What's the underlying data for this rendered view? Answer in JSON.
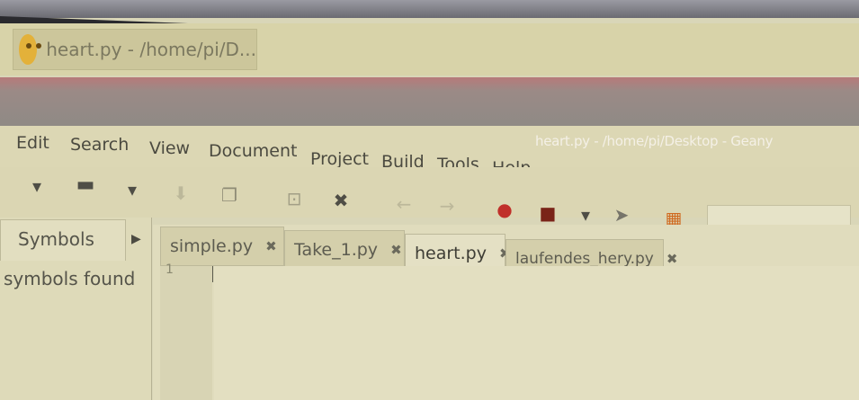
{
  "taskbar": {
    "window_label": "heart.py - /home/pi/D..."
  },
  "window": {
    "title": "heart.py - /home/pi/Desktop - Geany"
  },
  "menu": {
    "items": [
      "Edit",
      "Search",
      "View",
      "Document",
      "Project",
      "Build",
      "Tools",
      "Help"
    ]
  },
  "toolbar": {
    "icons": [
      "dropdown-arrow-icon",
      "open-folder-icon",
      "dropdown-arrow-icon",
      "save-icon",
      "save-all-icon",
      "revert-icon",
      "close-file-icon",
      "back-arrow-icon",
      "forward-arrow-icon",
      "compile-icon",
      "build-icon",
      "dropdown-arrow-icon",
      "execute-icon",
      "color-chooser-icon"
    ]
  },
  "sidebar": {
    "tab_label": "Symbols",
    "message": "symbols found"
  },
  "tabs": [
    {
      "label": "simple.py"
    },
    {
      "label": "Take_1.py"
    },
    {
      "label": "heart.py"
    },
    {
      "label": "laufendes_hery.py"
    }
  ],
  "editor": {
    "line_number": "1"
  }
}
